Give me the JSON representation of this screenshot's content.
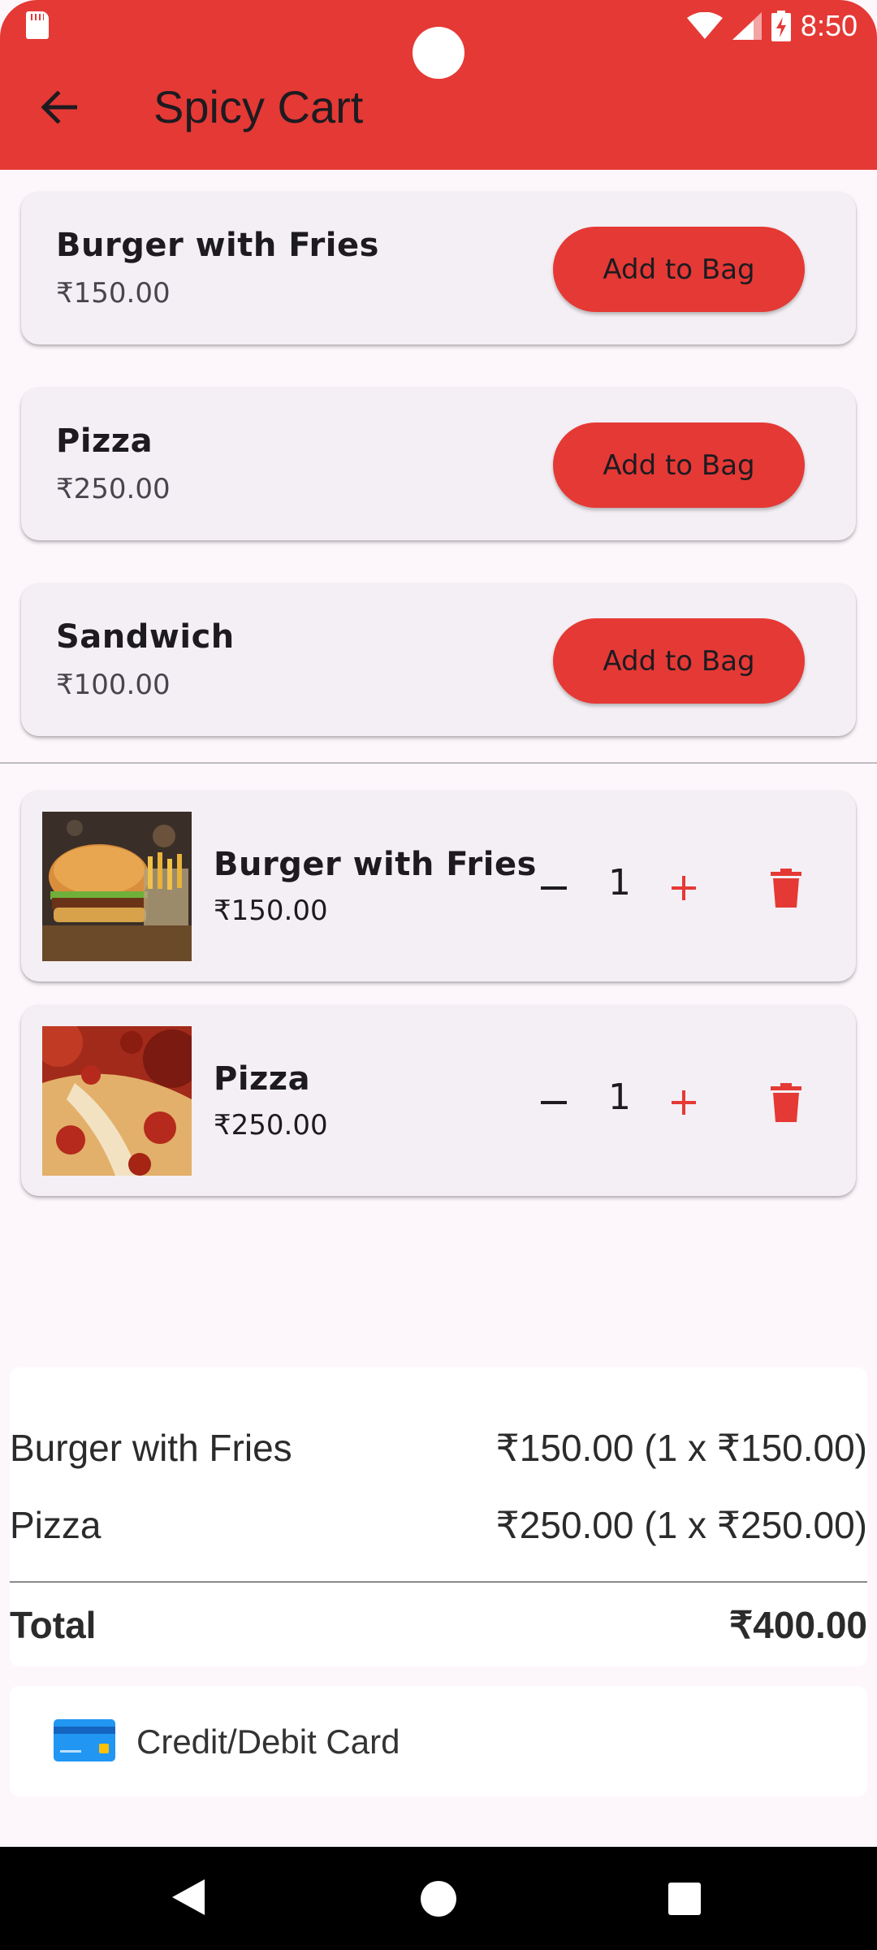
{
  "status_bar": {
    "time": "8:50",
    "icons": [
      "sd-card-icon",
      "wifi-icon",
      "signal-icon",
      "battery-charging-icon"
    ]
  },
  "app_bar": {
    "title": "Spicy Cart",
    "back_icon": "arrow-back-icon"
  },
  "products": [
    {
      "name": "Burger with Fries",
      "price": "₹150.00",
      "button_label": "Add to Bag"
    },
    {
      "name": "Pizza",
      "price": "₹250.00",
      "button_label": "Add to Bag"
    },
    {
      "name": "Sandwich",
      "price": "₹100.00",
      "button_label": "Add to Bag"
    }
  ],
  "cart": {
    "items": [
      {
        "name": "Burger with Fries",
        "price": "₹150.00",
        "quantity": "1",
        "image": "burger-with-fries-photo"
      },
      {
        "name": "Pizza",
        "price": "₹250.00",
        "quantity": "1",
        "image": "pizza-photo"
      }
    ]
  },
  "summary": {
    "lines": [
      {
        "label": "Burger with Fries",
        "value": "₹150.00 (1 x ₹150.00)"
      },
      {
        "label": "Pizza",
        "value": "₹250.00 (1 x ₹250.00)"
      }
    ],
    "total_label": "Total",
    "total_value": "₹400.00"
  },
  "payment": {
    "method_label": "Credit/Debit Card",
    "icon": "credit-card-icon"
  },
  "colors": {
    "accent": "#E53935",
    "background": "#FDF7FC",
    "card": "#F4EFF4"
  }
}
